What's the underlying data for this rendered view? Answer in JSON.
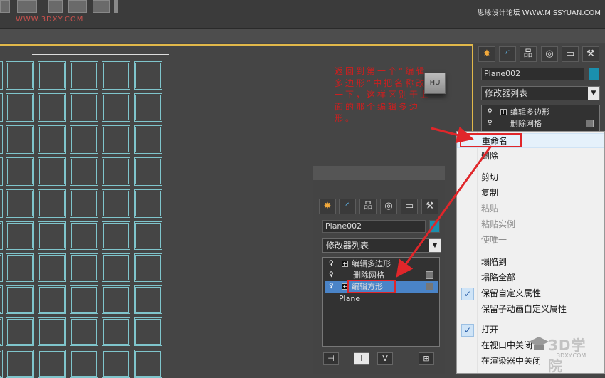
{
  "watermarks": {
    "top_left": "WWW.3DXY.COM",
    "top_right": "思缘设计论坛 WWW.MISSYUAN.COM",
    "logo_text": "3D学院",
    "logo_url": "3DXY.COM"
  },
  "annotation": {
    "text": "返回到第一个“编辑多边形”中把名称改一下，这样区别于上面的那个编辑多边形。",
    "icon_label": "HU"
  },
  "command_panel_top": {
    "tabs": [
      "✸",
      "◜",
      "品",
      "◎",
      "▭",
      "⚒"
    ],
    "object_name": "Plane002",
    "modifier_list": "修改器列表",
    "stack": [
      {
        "label": "编辑多边形",
        "has_plus": true
      },
      {
        "label": "删除网格",
        "has_plus": false
      }
    ]
  },
  "command_panel_bottom": {
    "tabs": [
      "✸",
      "◜",
      "品",
      "◎",
      "▭",
      "⚒"
    ],
    "object_name": "Plane002",
    "modifier_list": "修改器列表",
    "stack": [
      {
        "label": "编辑多边形",
        "has_plus": true,
        "selected": false
      },
      {
        "label": "删除网格",
        "has_plus": false,
        "selected": false
      },
      {
        "label": "编辑方形",
        "has_plus": true,
        "selected": true
      },
      {
        "label": "Plane",
        "has_plus": false,
        "selected": false
      }
    ],
    "bottom_buttons": [
      "⊣",
      "I",
      "∀",
      "⊞"
    ]
  },
  "context_menu": {
    "items": [
      {
        "label": "重命名",
        "disabled": false,
        "checked": false,
        "highlighted": true
      },
      {
        "label": "删除",
        "disabled": false,
        "checked": false
      },
      {
        "label": "剪切",
        "disabled": false,
        "checked": false
      },
      {
        "label": "复制",
        "disabled": false,
        "checked": false
      },
      {
        "label": "粘贴",
        "disabled": true,
        "checked": false
      },
      {
        "label": "粘贴实例",
        "disabled": true,
        "checked": false
      },
      {
        "label": "使唯一",
        "disabled": true,
        "checked": false
      },
      {
        "label": "塌陷到",
        "disabled": false,
        "checked": false
      },
      {
        "label": "塌陷全部",
        "disabled": false,
        "checked": false
      },
      {
        "label": "保留自定义属性",
        "disabled": false,
        "checked": true
      },
      {
        "label": "保留子动画自定义属性",
        "disabled": false,
        "checked": false
      },
      {
        "label": "打开",
        "disabled": false,
        "checked": true
      },
      {
        "label": "在视口中关闭",
        "disabled": false,
        "checked": false
      },
      {
        "label": "在渲染器中关闭",
        "disabled": false,
        "checked": false
      }
    ]
  },
  "colors": {
    "accent_red": "#e0262a",
    "viewport_border": "#e1b84a",
    "grid_line": "#7fc5cc",
    "selection_blue": "#4a84c8"
  }
}
